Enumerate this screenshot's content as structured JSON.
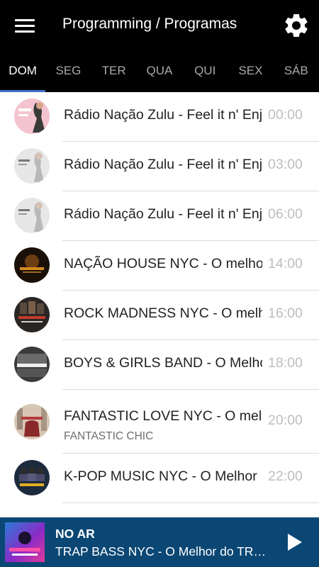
{
  "header": {
    "title": "Programming / Programas",
    "menu_icon": "hamburger-menu-icon",
    "settings_icon": "gear-icon"
  },
  "tabs": [
    {
      "label": "DOM",
      "active": true
    },
    {
      "label": "SEG",
      "active": false
    },
    {
      "label": "TER",
      "active": false
    },
    {
      "label": "QUA",
      "active": false
    },
    {
      "label": "QUI",
      "active": false
    },
    {
      "label": "SEX",
      "active": false
    },
    {
      "label": "SÁB",
      "active": false
    }
  ],
  "programs": [
    {
      "title": "Rádio Nação Zulu - Feel it n' Enjoy",
      "subtitle": "",
      "time": "00:00"
    },
    {
      "title": "Rádio Nação Zulu - Feel it n' Enjoy",
      "subtitle": "",
      "time": "03:00"
    },
    {
      "title": "Rádio Nação Zulu - Feel it n' Enjoy",
      "subtitle": "",
      "time": "06:00"
    },
    {
      "title": "NAÇÃO HOUSE NYC - O melhor",
      "subtitle": "",
      "time": "14:00"
    },
    {
      "title": "ROCK MADNESS NYC - O melhor",
      "subtitle": "",
      "time": "16:00"
    },
    {
      "title": "BOYS & GIRLS BAND - O Melhor",
      "subtitle": "",
      "time": "18:00"
    },
    {
      "title": "FANTASTIC LOVE NYC - O melhor",
      "subtitle": "FANTASTIC CHIC",
      "time": "20:00"
    },
    {
      "title": "K-POP MUSIC NYC - O Melhor",
      "subtitle": "",
      "time": "22:00"
    }
  ],
  "player": {
    "status": "NO AR",
    "now_playing": "TRAP BASS NYC - O Melhor do TRAP BASS NYC",
    "play_icon": "play-icon"
  },
  "colors": {
    "appbar": "#000000",
    "tab_indicator": "#3f71c7",
    "player_bar": "#0b4774",
    "time_text": "#bdbdbd"
  }
}
